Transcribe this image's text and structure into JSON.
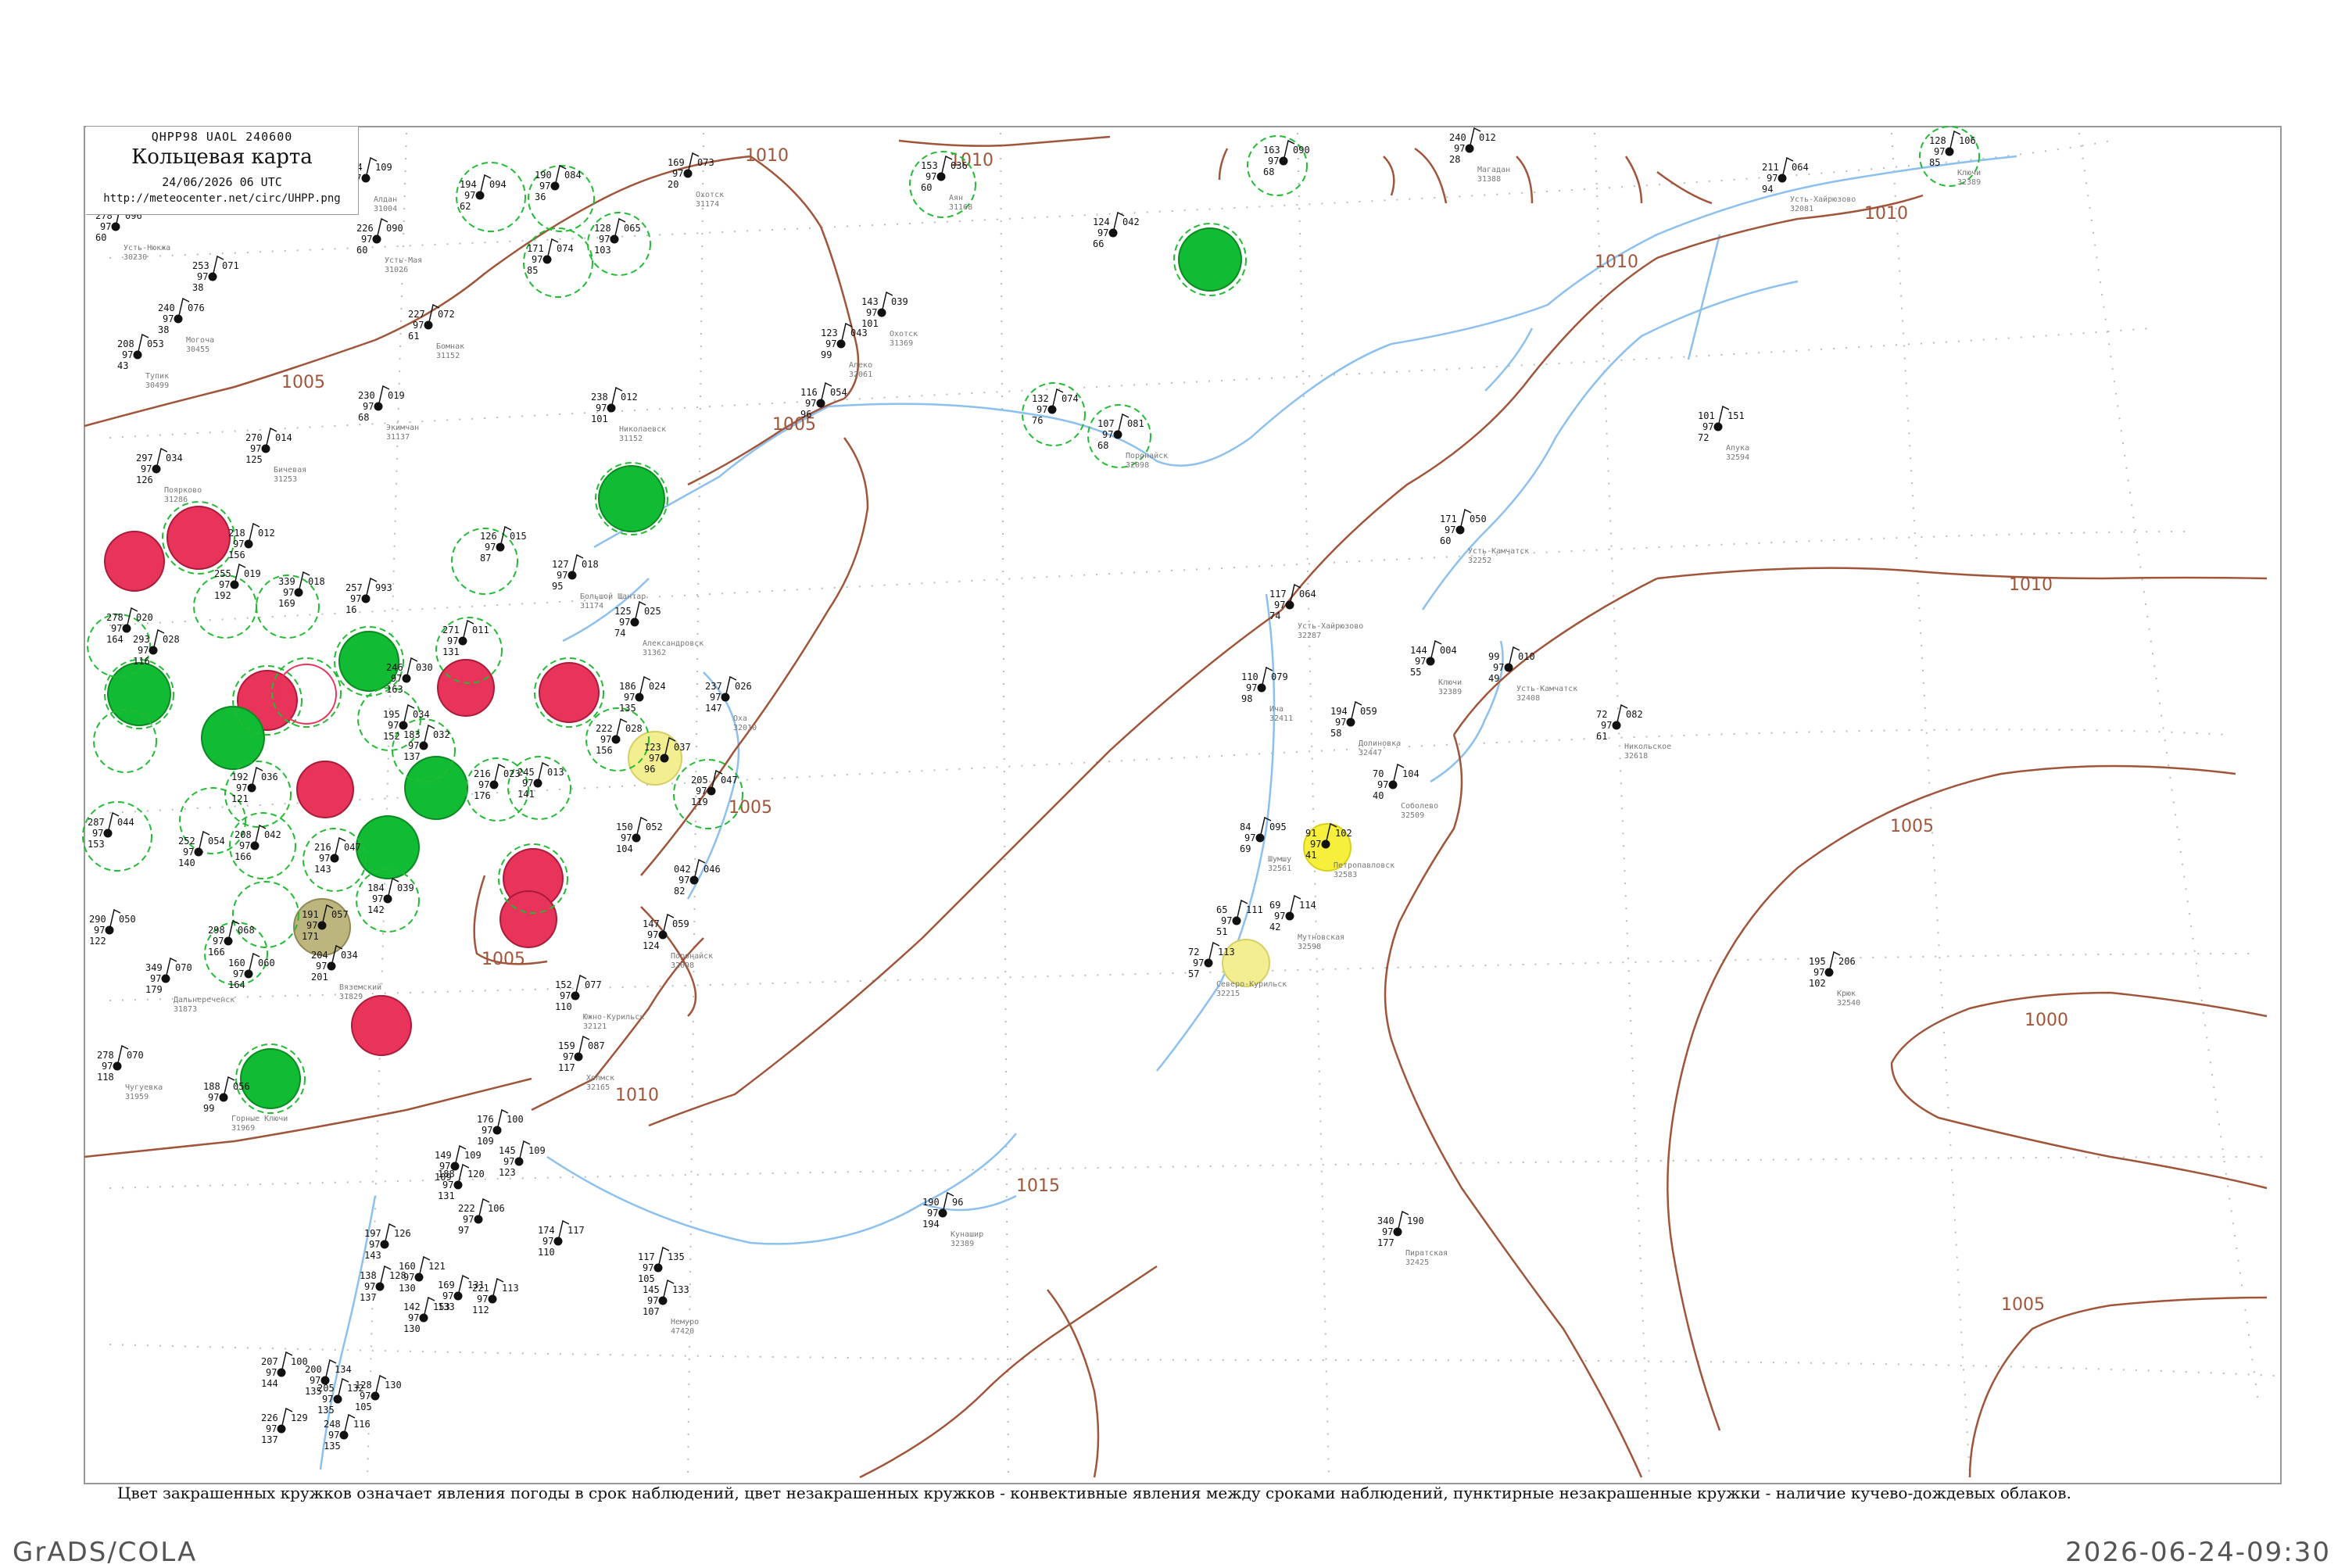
{
  "header": {
    "code": "QHPP98  UAOL  240600",
    "title": "Кольцевая карта",
    "time": "24/06/2026 06 UTC",
    "url": "http://meteocenter.net/circ/UHPP.png"
  },
  "caption": "Цвет закрашенных кружков означает явления погоды в срок наблюдений, цвет незакрашенных кружков - конвективные явления между сроками наблюдений, пунктирные незакрашенные кружки - наличие кучево-дождевых облаков.",
  "footer": {
    "left": "GrADS/COLA",
    "right": "2026-06-24-09:30"
  },
  "colors": {
    "isobar": "#a0553a",
    "river": "#8cc0ee",
    "thunder": "#e8335a",
    "rain": "#11bb33",
    "fog_yellow": "#f6f03c",
    "pale_yellow": "#f3ef90",
    "haze": "#bcb57e",
    "cb_ring": "#22bb33",
    "frame": "#999999"
  },
  "isobar_labels": [
    "1005",
    "1010",
    "1010",
    "1005",
    "1010",
    "1010",
    "1010",
    "1005",
    "1005",
    "1010",
    "1015",
    "1000",
    "1005",
    "1005"
  ],
  "stations": [
    {
      "p": "096",
      "t": "278",
      "dew": "60",
      "id": "30230",
      "name": "Усть-Нюкжа"
    },
    {
      "p": "071",
      "t": "253",
      "dew": "38"
    },
    {
      "p": "053",
      "t": "208",
      "dew": "43",
      "id": "30499",
      "name": "Тупик"
    },
    {
      "p": "076",
      "t": "240",
      "dew": "38",
      "id": "30455",
      "name": "Могоча"
    },
    {
      "p": "109",
      "t": "224",
      "dew": "47",
      "id": "31004",
      "name": "Алдан"
    },
    {
      "p": "090",
      "t": "226",
      "dew": "60",
      "id": "31026",
      "name": "Усть-Мая"
    },
    {
      "p": "072",
      "t": "227",
      "dew": "61",
      "id": "31152",
      "name": "Бомнак"
    },
    {
      "p": "094",
      "t": "194",
      "dew": "62"
    },
    {
      "p": "084",
      "t": "190",
      "dew": "36"
    },
    {
      "p": "074",
      "t": "171",
      "dew": "85"
    },
    {
      "p": "065",
      "t": "128",
      "dew": "103"
    },
    {
      "p": "073",
      "t": "169",
      "dew": "20",
      "id": "31174",
      "name": "Охотск"
    },
    {
      "p": "036",
      "t": "153",
      "dew": "60",
      "id": "31168",
      "name": "Аян"
    },
    {
      "p": "090",
      "t": "163",
      "dew": "68"
    },
    {
      "p": "012",
      "t": "240",
      "dew": "28",
      "id": "31388",
      "name": "Магадан"
    },
    {
      "p": "064",
      "t": "211",
      "dew": "94",
      "id": "32081",
      "name": "Усть-Хайрюзово"
    },
    {
      "p": "106",
      "t": "128",
      "dew": "85",
      "id": "32389",
      "name": "Ключи"
    },
    {
      "p": "042",
      "t": "124",
      "dew": "66"
    },
    {
      "p": "019",
      "t": "230",
      "dew": "68",
      "id": "31137",
      "name": "Экимчан"
    },
    {
      "p": "012",
      "t": "238",
      "dew": "101",
      "id": "31152",
      "name": "Николаевск"
    },
    {
      "p": "039",
      "t": "143",
      "dew": "101",
      "id": "31369",
      "name": "Охотск"
    },
    {
      "p": "043",
      "t": "123",
      "dew": "99",
      "id": "32061",
      "name": "Алеко"
    },
    {
      "p": "054",
      "t": "116",
      "dew": "96"
    },
    {
      "p": "074",
      "t": "132",
      "dew": "76"
    },
    {
      "p": "081",
      "t": "107",
      "dew": "68",
      "id": "32098",
      "name": "Поронайск"
    },
    {
      "p": "014",
      "t": "270",
      "dew": "125",
      "id": "31253",
      "name": "Бичевая"
    },
    {
      "p": "034",
      "t": "297",
      "dew": "126",
      "id": "31286",
      "name": "Поярково"
    },
    {
      "p": "012",
      "t": "218",
      "dew": "156"
    },
    {
      "p": "019",
      "t": "255",
      "dew": "192"
    },
    {
      "p": "018",
      "t": "339",
      "dew": "169"
    },
    {
      "p": "993",
      "t": "257",
      "dew": "16"
    },
    {
      "p": "015",
      "t": "126",
      "dew": "87"
    },
    {
      "p": "018",
      "t": "127",
      "dew": "95",
      "id": "31174",
      "name": "Большой Шантар"
    },
    {
      "p": "025",
      "t": "125",
      "dew": "74",
      "id": "31362",
      "name": "Александровск"
    },
    {
      "p": "020",
      "t": "278",
      "dew": "164"
    },
    {
      "p": "028",
      "t": "293",
      "dew": "116"
    },
    {
      "p": "011",
      "t": "271",
      "dew": "131"
    },
    {
      "p": "030",
      "t": "246",
      "dew": "163"
    },
    {
      "p": "034",
      "t": "195",
      "dew": "152"
    },
    {
      "p": "036",
      "t": "192",
      "dew": "121"
    },
    {
      "p": "032",
      "t": "183",
      "dew": "137"
    },
    {
      "p": "023",
      "t": "216",
      "dew": "176"
    },
    {
      "p": "013",
      "t": "245",
      "dew": "141"
    },
    {
      "p": "024",
      "t": "186",
      "dew": "135"
    },
    {
      "p": "026",
      "t": "237",
      "dew": "147",
      "id": "32010",
      "name": "Оха"
    },
    {
      "p": "028",
      "t": "222",
      "dew": "156"
    },
    {
      "p": "037",
      "t": "123",
      "dew": "96"
    },
    {
      "p": "047",
      "t": "205",
      "dew": "119"
    },
    {
      "p": "044",
      "t": "287",
      "dew": "153"
    },
    {
      "p": "054",
      "t": "252",
      "dew": "140"
    },
    {
      "p": "042",
      "t": "208",
      "dew": "166"
    },
    {
      "p": "047",
      "t": "216",
      "dew": "143"
    },
    {
      "p": "039",
      "t": "184",
      "dew": "142"
    },
    {
      "p": "052",
      "t": "150",
      "dew": "104"
    },
    {
      "p": "046",
      "t": "042",
      "dew": "82"
    },
    {
      "p": "059",
      "t": "147",
      "dew": "124",
      "id": "32098",
      "name": "Поронайск"
    },
    {
      "p": "050",
      "t": "290",
      "dew": "122"
    },
    {
      "p": "057",
      "t": "191",
      "dew": "171"
    },
    {
      "p": "034",
      "t": "204",
      "dew": "201",
      "id": "31829",
      "name": "Вяземский"
    },
    {
      "p": "068",
      "t": "298",
      "dew": "166"
    },
    {
      "p": "060",
      "t": "160",
      "dew": "164"
    },
    {
      "p": "070",
      "t": "349",
      "dew": "179",
      "id": "31873",
      "name": "Дальнереченск"
    },
    {
      "p": "077",
      "t": "152",
      "dew": "110",
      "id": "32121",
      "name": "Южно-Курильск"
    },
    {
      "p": "070",
      "t": "278",
      "dew": "118",
      "id": "31959",
      "name": "Чугуевка"
    },
    {
      "p": "087",
      "t": "159",
      "dew": "117",
      "id": "32165",
      "name": "Холмск"
    },
    {
      "p": "056",
      "t": "188",
      "dew": "99",
      "id": "31969",
      "name": "Горные Ключи"
    },
    {
      "p": "050",
      "t": "171",
      "dew": "60",
      "id": "32252",
      "name": "Усть-Камчатск"
    },
    {
      "p": "064",
      "t": "117",
      "dew": "74",
      "id": "32287",
      "name": "Усть-Хайрюзово"
    },
    {
      "p": "079",
      "t": "110",
      "dew": "98",
      "id": "32411",
      "name": "Ича"
    },
    {
      "p": "004",
      "t": "144",
      "dew": "55",
      "id": "32389",
      "name": "Ключи"
    },
    {
      "p": "010",
      "t": "99",
      "dew": "49",
      "id": "32408",
      "name": "Усть-Камчатск"
    },
    {
      "p": "059",
      "t": "194",
      "dew": "58",
      "id": "32447",
      "name": "Долиновка"
    },
    {
      "p": "104",
      "t": "70",
      "dew": "40",
      "id": "32509",
      "name": "Соболево"
    },
    {
      "p": "095",
      "t": "84",
      "dew": "69",
      "id": "32561",
      "name": "Шумшу"
    },
    {
      "p": "102",
      "t": "91",
      "dew": "41",
      "id": "32583",
      "name": "Петропавловск"
    },
    {
      "p": "114",
      "t": "69",
      "dew": "42",
      "id": "32598",
      "name": "Мутновская"
    },
    {
      "p": "111",
      "t": "65",
      "dew": "51"
    },
    {
      "p": "113",
      "t": "72",
      "dew": "57",
      "id": "32215",
      "name": "Северо-Курильск"
    },
    {
      "p": "082",
      "t": "72",
      "dew": "61",
      "id": "32618",
      "name": "Никольское"
    },
    {
      "p": "151",
      "t": "101",
      "dew": "72",
      "id": "32594",
      "name": "Апука"
    },
    {
      "p": "206",
      "t": "195",
      "dew": "102",
      "id": "32540",
      "name": "Крюк"
    },
    {
      "p": "100",
      "t": "176",
      "dew": "109"
    },
    {
      "p": "109",
      "t": "145",
      "dew": "123"
    },
    {
      "p": "109",
      "t": "149",
      "dew": "109"
    },
    {
      "p": "120",
      "t": "188",
      "dew": "131"
    },
    {
      "p": "106",
      "t": "222",
      "dew": "97"
    },
    {
      "p": "117",
      "t": "174",
      "dew": "110"
    },
    {
      "p": "135",
      "t": "117",
      "dew": "105"
    },
    {
      "p": "133",
      "t": "145",
      "dew": "107",
      "id": "47420",
      "name": "Немуро"
    },
    {
      "p": "126",
      "t": "197",
      "dew": "143"
    },
    {
      "p": "121",
      "t": "160",
      "dew": "130"
    },
    {
      "p": "131",
      "t": "169",
      "dew": "133"
    },
    {
      "p": "113",
      "t": "221",
      "dew": "112"
    },
    {
      "p": "128",
      "t": "138",
      "dew": "137"
    },
    {
      "p": "153",
      "t": "142",
      "dew": "130"
    },
    {
      "p": "96",
      "t": "190",
      "dew": "194",
      "id": "32389",
      "name": "Кунашир"
    },
    {
      "p": "190",
      "t": "340",
      "dew": "177",
      "id": "32425",
      "name": "Пиратская"
    },
    {
      "p": "100",
      "t": "207",
      "dew": "144"
    },
    {
      "p": "134",
      "t": "200",
      "dew": "135"
    },
    {
      "p": "132",
      "t": "205",
      "dew": "135"
    },
    {
      "p": "129",
      "t": "226",
      "dew": "137"
    },
    {
      "p": "116",
      "t": "248",
      "dew": "135"
    },
    {
      "p": "130",
      "t": "128",
      "dew": "105"
    }
  ]
}
